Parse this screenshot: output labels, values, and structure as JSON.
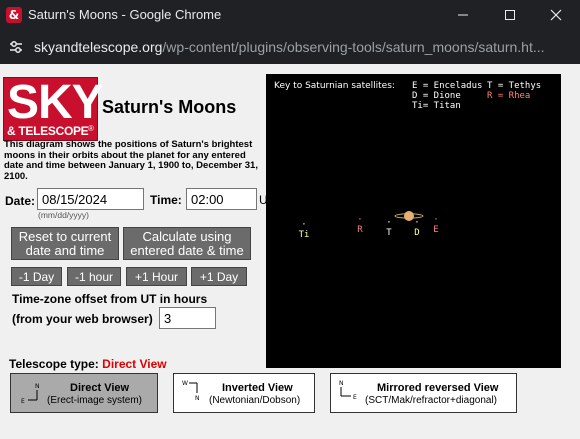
{
  "window": {
    "title": "Saturn's Moons - Google Chrome",
    "app_icon": "&",
    "url_host": "skyandtelescope.org",
    "url_path": "/wp-content/plugins/observing-tools/saturn_moons/saturn.ht..."
  },
  "logo": {
    "line1": "SKY",
    "line2": "& TELESCOPE",
    "reg": "®"
  },
  "page": {
    "title": "Saturn's Moons",
    "intro": "This diagram shows the positions of Saturn's brightest moons in their orbits about the planet for any entered date and time between January 1, 1900 to, December 31, 2100."
  },
  "form": {
    "date_label": "Date:",
    "date_value": "08/15/2024",
    "date_hint": "(mm/dd/yyyy)",
    "time_label": "Time:",
    "time_value": "02:00",
    "time_suffix": "U",
    "reset_line1": "Reset to current",
    "reset_line2": "date and time",
    "calc_line1": "Calculate using",
    "calc_line2": "entered date & time",
    "minus_day": "-1 Day",
    "minus_hour": "-1 hour",
    "plus_hour": "+1 Hour",
    "plus_day": "+1 Day",
    "tz_line1": "Time-zone offset from UT in hours",
    "tz_line2": "(from your web browser)",
    "tz_value": "3"
  },
  "telescope": {
    "label": "Telescope type:",
    "value": "Direct View",
    "views": [
      {
        "title": "Direct View",
        "subtitle": "(Erect-image system)",
        "active": true
      },
      {
        "title": "Inverted View",
        "subtitle": "(Newtonian/Dobson)",
        "active": false
      },
      {
        "title": "Mirrored reversed View",
        "subtitle": "(SCT/Mak/refractor+diagonal)",
        "active": false
      }
    ],
    "orient_n": "N",
    "orient_e": "E",
    "orient_w": "W"
  },
  "satellites": {
    "key_label": "Key to Saturnian satellites:",
    "key_items": [
      {
        "text": "E = Enceladus",
        "color": "#ffffff"
      },
      {
        "text": "T = Tethys",
        "color": "#ffffff"
      },
      {
        "text": "D = Dione",
        "color": "#ffffff"
      },
      {
        "text": "R = Rhea",
        "color": "#ff8080"
      },
      {
        "text": "Ti= Titan",
        "color": "#ffffff"
      }
    ],
    "moons": [
      {
        "label": "Ti",
        "color": "#ffff99"
      },
      {
        "label": "R",
        "color": "#ff8080"
      },
      {
        "label": "T",
        "color": "#ffffff"
      },
      {
        "label": "D",
        "color": "#ffff99"
      },
      {
        "label": "E",
        "color": "#ff8080"
      }
    ],
    "planet_color": "#e8b070"
  }
}
